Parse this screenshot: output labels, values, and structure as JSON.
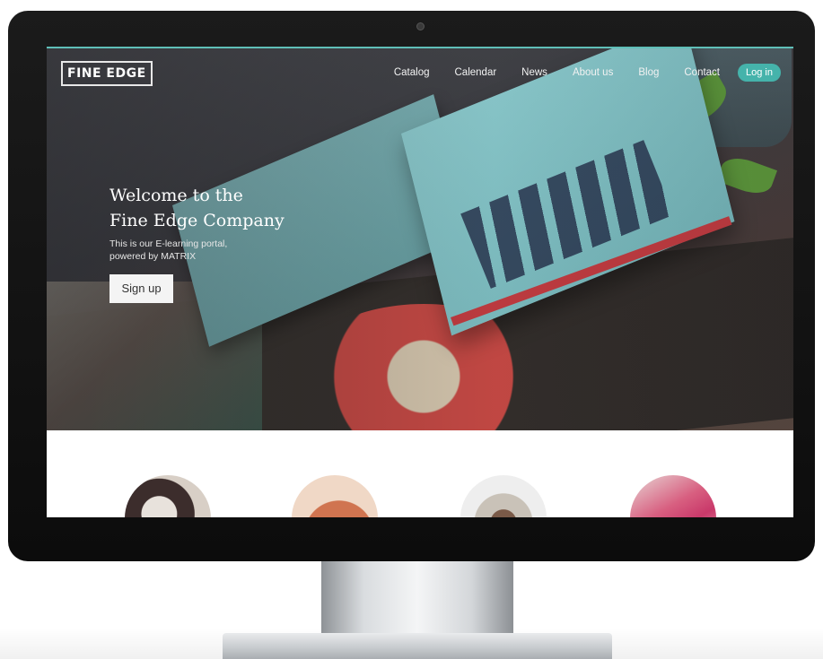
{
  "brand": {
    "logo_text": "FINE EDGE"
  },
  "nav": {
    "links": [
      "Catalog",
      "Calendar",
      "News",
      "About us",
      "Blog",
      "Contact"
    ],
    "login_label": "Log in"
  },
  "hero": {
    "title_line1": "Welcome to the",
    "title_line2": "Fine Edge Company",
    "subtitle_line1": "This is our E-learning portal,",
    "subtitle_line2": "powered by MATRIX",
    "signup_label": "Sign up"
  },
  "colors": {
    "accent": "#45b3ab",
    "bezel": "#111111"
  }
}
